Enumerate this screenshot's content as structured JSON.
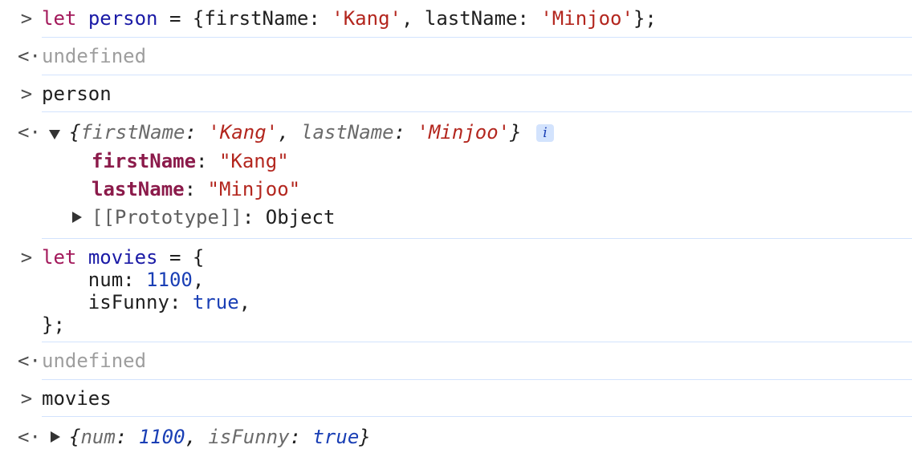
{
  "prompts": {
    "input": ">",
    "output": "<·"
  },
  "entry1": {
    "kw": "let",
    "var": "person",
    "eq": " = {firstName: ",
    "s1": "'Kang'",
    "mid": ", lastName: ",
    "s2": "'Minjoo'",
    "end": "};"
  },
  "result1": "undefined",
  "entry2": "person",
  "result2": {
    "preview_open": "{",
    "k1": "firstName",
    "colon1": ": ",
    "v1": "'Kang'",
    "comma": ", ",
    "k2": "lastName",
    "colon2": ": ",
    "v2": "'Minjoo'",
    "preview_close": "}",
    "info": "i",
    "props": [
      {
        "key": "firstName",
        "value": "\"Kang\""
      },
      {
        "key": "lastName",
        "value": "\"Minjoo\""
      }
    ],
    "proto_key": "[[Prototype]]",
    "proto_colon": ": ",
    "proto_value": "Object"
  },
  "entry3": {
    "kw": "let",
    "var": "movies",
    "l1rest": " = {",
    "l2key": "    num: ",
    "l2val": "1100",
    "l2end": ",",
    "l3key": "    isFunny: ",
    "l3val": "true",
    "l3end": ",",
    "l4": "};"
  },
  "result3": "undefined",
  "entry4": "movies",
  "result4": {
    "open": "{",
    "k1": "num",
    "colon1": ": ",
    "v1": "1100",
    "comma": ", ",
    "k2": "isFunny",
    "colon2": ": ",
    "v2": "true",
    "close": "}"
  }
}
